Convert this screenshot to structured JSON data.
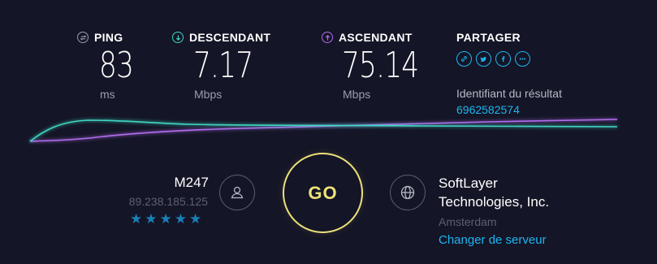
{
  "metrics": {
    "ping": {
      "label": "PING",
      "value": "83",
      "unit": "ms"
    },
    "download": {
      "label": "DESCENDANT",
      "value": "7.17",
      "unit": "Mbps"
    },
    "upload": {
      "label": "ASCENDANT",
      "value": "75.14",
      "unit": "Mbps"
    }
  },
  "share": {
    "title": "PARTAGER",
    "icons": [
      "link-icon",
      "twitter-icon",
      "facebook-icon",
      "more-icon"
    ],
    "result_label": "Identifiant du résultat",
    "result_id": "6962582574"
  },
  "isp": {
    "name": "M247",
    "ip": "89.238.185.125",
    "rating": 5
  },
  "go_label": "GO",
  "server": {
    "name_line1": "SoftLayer",
    "name_line2": "Technologies, Inc.",
    "location": "Amsterdam",
    "change_label": "Changer de serveur"
  },
  "colors": {
    "background": "#141526",
    "download": "#3fd6c2",
    "upload": "#b36df0",
    "accent": "#1fb5f0",
    "go": "#ede27a"
  }
}
